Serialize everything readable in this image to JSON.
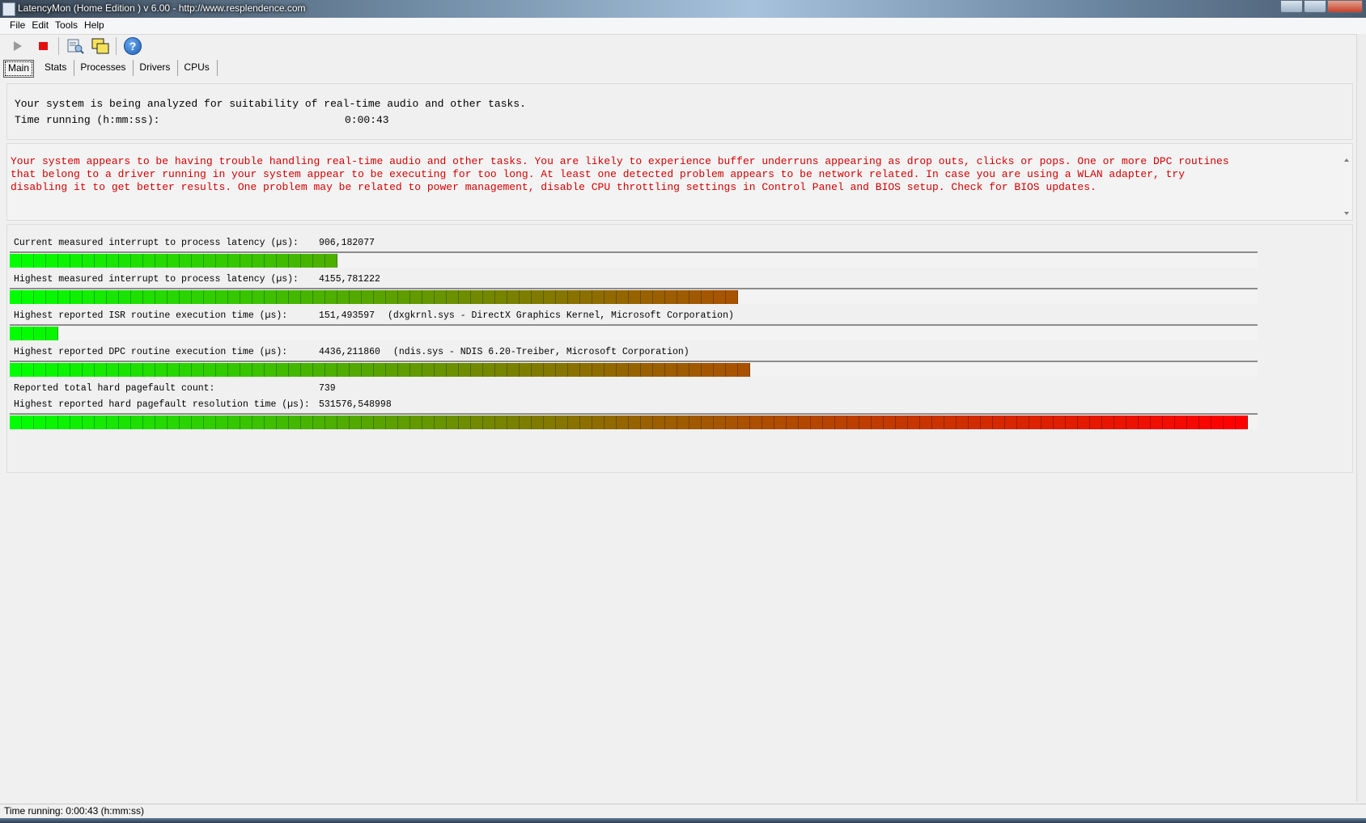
{
  "window": {
    "title": "LatencyMon  (Home Edition )  v 6.00 - http://www.resplendence.com"
  },
  "menu": [
    "File",
    "Edit",
    "Tools",
    "Help"
  ],
  "toolbar": {
    "buttons": [
      "play-icon",
      "stop-icon",
      "report-icon",
      "window-icon",
      "help-icon"
    ],
    "help_glyph": "?"
  },
  "tabs": [
    "Main",
    "Stats",
    "Processes",
    "Drivers",
    "CPUs"
  ],
  "status": {
    "analysis_line": "Your system is being analyzed for suitability of real-time audio and other tasks.",
    "time_label": "Time running (h:mm:ss):",
    "time_value": "0:00:43"
  },
  "warning": "Your system appears to be having trouble handling real-time audio and other tasks. You are likely to experience buffer underruns appearing as drop outs, clicks or pops. One or more DPC routines that belong to a driver running in your system appear to be executing for too long. At least one detected problem appears to be network related. In case you are using a WLAN adapter, try disabling it to get better results. One problem may be related to power management, disable CPU throttling settings in Control Panel and BIOS setup. Check for BIOS updates.",
  "metrics": [
    {
      "label": "Current measured interrupt to process latency (µs):",
      "value": "906,182077",
      "detail": "",
      "bar_fraction": 0.26
    },
    {
      "label": "Highest measured interrupt to process latency (µs):",
      "value": "4155,781222",
      "detail": "",
      "bar_fraction": 0.59
    },
    {
      "label": "Highest reported ISR routine execution time (µs):",
      "value": "151,493597",
      "detail": "(dxgkrnl.sys - DirectX Graphics Kernel, Microsoft Corporation)",
      "bar_fraction": 0.04
    },
    {
      "label": "Highest reported DPC routine execution time (µs):",
      "value": "4436,211860",
      "detail": "(ndis.sys - NDIS 6.20-Treiber, Microsoft Corporation)",
      "bar_fraction": 0.6
    },
    {
      "label": "Reported total hard pagefault count:",
      "value": "739",
      "detail": ""
    },
    {
      "label": "Highest reported hard pagefault resolution time (µs):",
      "value": "531576,548998",
      "detail": "",
      "bar_fraction": 1.0
    }
  ],
  "statusbar": "Time running: 0:00:43  (h:mm:ss)",
  "colors": {
    "warning_text": "#d40000",
    "bar_low": "#00ff00",
    "bar_high": "#ff0000"
  }
}
